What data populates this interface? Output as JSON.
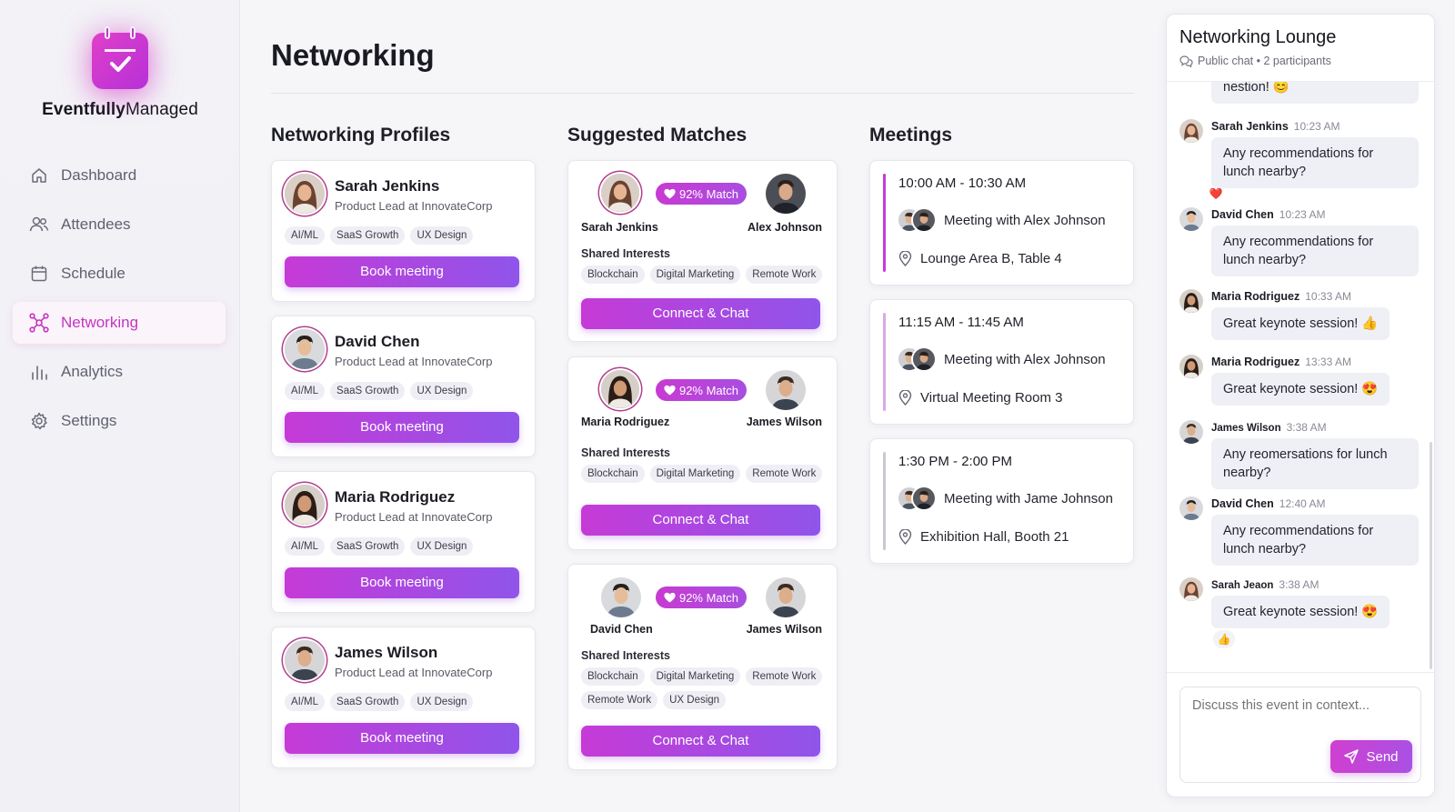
{
  "app": {
    "name_bold": "Eventfully",
    "name_light": "Managed"
  },
  "nav": [
    {
      "label": "Dashboard",
      "icon": "home-icon",
      "active": false
    },
    {
      "label": "Attendees",
      "icon": "users-icon",
      "active": false
    },
    {
      "label": "Schedule",
      "icon": "calendar-icon",
      "active": false
    },
    {
      "label": "Networking",
      "icon": "network-icon",
      "active": true
    },
    {
      "label": "Analytics",
      "icon": "bar-chart-icon",
      "active": false
    },
    {
      "label": "Settings",
      "icon": "gear-icon",
      "active": false
    }
  ],
  "page": {
    "title": "Networking"
  },
  "profiles": {
    "title": "Networking Profiles",
    "button_label": "Book meeting",
    "items": [
      {
        "name": "Sarah Jenkins",
        "role": "Product Lead at InnovateCorp",
        "tags": [
          "AI/ML",
          "SaaS Growth",
          "UX Design"
        ]
      },
      {
        "name": "David Chen",
        "role": "Product Lead at InnovateCorp",
        "tags": [
          "AI/ML",
          "SaaS Growth",
          "UX Design"
        ]
      },
      {
        "name": "Maria Rodriguez",
        "role": "Product Lead at InnovateCorp",
        "tags": [
          "AI/ML",
          "SaaS Growth",
          "UX Design"
        ]
      },
      {
        "name": "James Wilson",
        "role": "Product Lead at InnovateCorp",
        "tags": [
          "AI/ML",
          "SaaS Growth",
          "UX Design"
        ]
      }
    ]
  },
  "matches": {
    "title": "Suggested Matches",
    "shared_label": "Shared Interests",
    "button_label": "Connect & Chat",
    "items": [
      {
        "left": "Sarah Jenkins",
        "right": "Alex Johnson",
        "match": "92% Match",
        "interests": [
          "Blockchain",
          "Digital Marketing",
          "Remote Work"
        ]
      },
      {
        "left": "Maria Rodriguez",
        "right": "James Wilson",
        "match": "92% Match",
        "interests": [
          "Blockchain",
          "Digital Marketing",
          "Remote Work"
        ]
      },
      {
        "left": "David Chen",
        "right": "James Wilson",
        "match": "92% Match",
        "interests": [
          "Blockchain",
          "Digital Marketing",
          "Remote Work",
          "Remote Work",
          "UX Design"
        ]
      }
    ]
  },
  "meetings": {
    "title": "Meetings",
    "items": [
      {
        "time": "10:00 AM - 10:30 AM",
        "with": "Meeting with Alex Johnson",
        "location": "Lounge Area B, Table 4",
        "accent": "#c63ad7"
      },
      {
        "time": "11:15 AM - 11:45 AM",
        "with": "Meeting with Alex Johnson",
        "location": "Virtual Meeting Room 3",
        "accent": "#d9a9e6"
      },
      {
        "time": "1:30 PM - 2:00 PM",
        "with": "Meeting with Jame Johnson",
        "location": "Exhibition Hall, Booth 21",
        "accent": "#c8c8d0"
      }
    ]
  },
  "chat": {
    "title": "Networking Lounge",
    "subtitle": "Public chat • 2 participants",
    "partial_text": "nestion! 😊",
    "messages": [
      {
        "name": "Sarah Jenkins",
        "time": "10:23 AM",
        "text": "Any recommendations for lunch nearby?",
        "reaction": "❤️"
      },
      {
        "name": "David Chen",
        "time": "10:23 AM",
        "text": "Any recommendations for lunch nearby?",
        "reaction": ""
      },
      {
        "name": "Maria Rodriguez",
        "time": "10:33 AM",
        "text": "Great keynote session! 👍",
        "reaction": ""
      },
      {
        "name": "Maria Rodriguez",
        "time": "13:33 AM",
        "text": "Great keynote session! 😍",
        "reaction": ""
      },
      {
        "name": "James Wilson",
        "time": "3:38 AM",
        "text": "Any reomersations for lunch nearby?",
        "reaction": ""
      },
      {
        "name": "David Chen",
        "time": "12:40 AM",
        "text": "Any recommendations for lunch nearby?",
        "reaction": ""
      },
      {
        "name": "Sarah Jeaon",
        "time": "3:38 AM",
        "text": "Great keynote session! 😍",
        "reaction": "👍"
      }
    ],
    "input_placeholder": "Discuss this event in context...",
    "send_label": "Send"
  },
  "colors": {
    "brand": "#c63ad7",
    "brand_end": "#8f55ea",
    "tag_bg": "#f0eef5"
  }
}
